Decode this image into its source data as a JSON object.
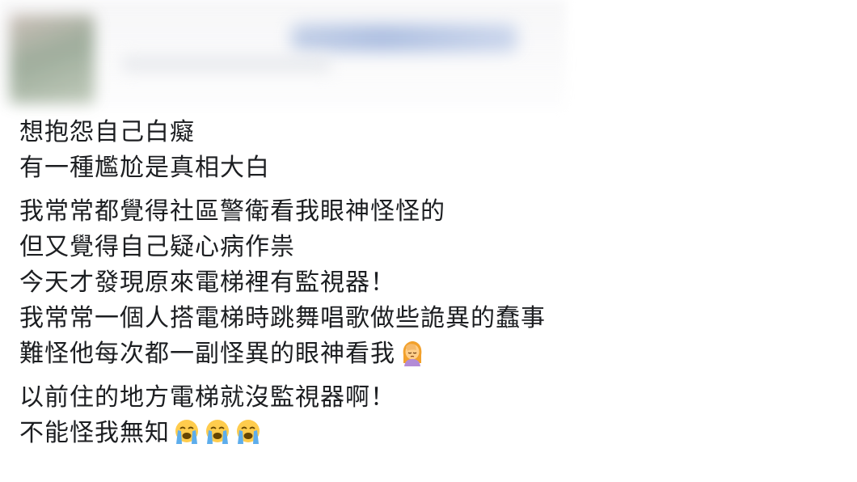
{
  "post": {
    "paragraphs": [
      {
        "lines": [
          {
            "text": "想抱怨自己白癡"
          },
          {
            "text": "有一種尷尬是真相大白"
          }
        ]
      },
      {
        "lines": [
          {
            "text": "我常常都覺得社區警衛看我眼神怪怪的"
          },
          {
            "text": "但又覺得自己疑心病作祟"
          },
          {
            "text": "今天才發現原來電梯裡有監視器！"
          },
          {
            "text": "我常常一個人搭電梯時跳舞唱歌做些詭異的蠢事"
          },
          {
            "text": "難怪他每次都一副怪異的眼神看我",
            "emoji": [
              "woman-facepalming-icon"
            ]
          }
        ]
      },
      {
        "lines": [
          {
            "text": "以前住的地方電梯就沒監視器啊！"
          },
          {
            "text": "不能怪我無知",
            "emoji": [
              "loudly-crying-face-icon",
              "loudly-crying-face-icon",
              "loudly-crying-face-icon"
            ]
          }
        ]
      }
    ]
  },
  "colors": {
    "text": "#1c1e21",
    "background": "#ffffff"
  }
}
